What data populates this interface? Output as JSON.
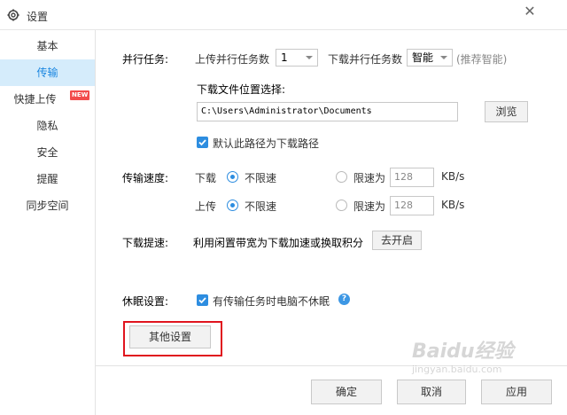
{
  "window": {
    "title": "设置",
    "close_glyph": "✕",
    "icon": "gear-icon"
  },
  "sidebar": {
    "items": [
      {
        "label": "基本"
      },
      {
        "label": "传输",
        "active": true
      },
      {
        "label": "快捷上传",
        "badge": "NEW"
      },
      {
        "label": "隐私"
      },
      {
        "label": "安全"
      },
      {
        "label": "提醒"
      },
      {
        "label": "同步空间"
      }
    ]
  },
  "parallel": {
    "label": "并行任务:",
    "upload_label": "上传并行任务数",
    "upload_value": "1",
    "download_label": "下载并行任务数",
    "download_value": "智能",
    "hint": "(推荐智能)"
  },
  "download_location": {
    "label": "下载文件位置选择:",
    "path": "C:\\Users\\Administrator\\Documents",
    "browse_label": "浏览",
    "default_checkbox_label": "默认此路径为下载路径",
    "default_checked": true
  },
  "speed": {
    "label": "传输速度:",
    "download": {
      "label": "下载",
      "unlimited_label": "不限速",
      "limit_label": "限速为",
      "limit_value": "128",
      "unit": "KB/s",
      "selected": "unlimited"
    },
    "upload": {
      "label": "上传",
      "unlimited_label": "不限速",
      "limit_label": "限速为",
      "limit_value": "128",
      "unit": "KB/s",
      "selected": "unlimited"
    }
  },
  "accelerate": {
    "label": "下载提速:",
    "description": "利用闲置带宽为下载加速或换取积分",
    "button_label": "去开启"
  },
  "sleep": {
    "label": "休眠设置:",
    "checkbox_label": "有传输任务时电脑不休眠",
    "checked": true,
    "help_glyph": "?"
  },
  "other_settings": {
    "label": "其他设置"
  },
  "footer": {
    "ok_label": "确定",
    "cancel_label": "取消",
    "apply_label": "应用"
  },
  "watermark": {
    "text": "Baidu经验",
    "subtext": "jingyan.baidu.com"
  },
  "colors": {
    "accent": "#1a86e0",
    "active_bg": "#d5ecfb",
    "highlight_border": "#e0141e",
    "badge": "#f24b4b"
  }
}
